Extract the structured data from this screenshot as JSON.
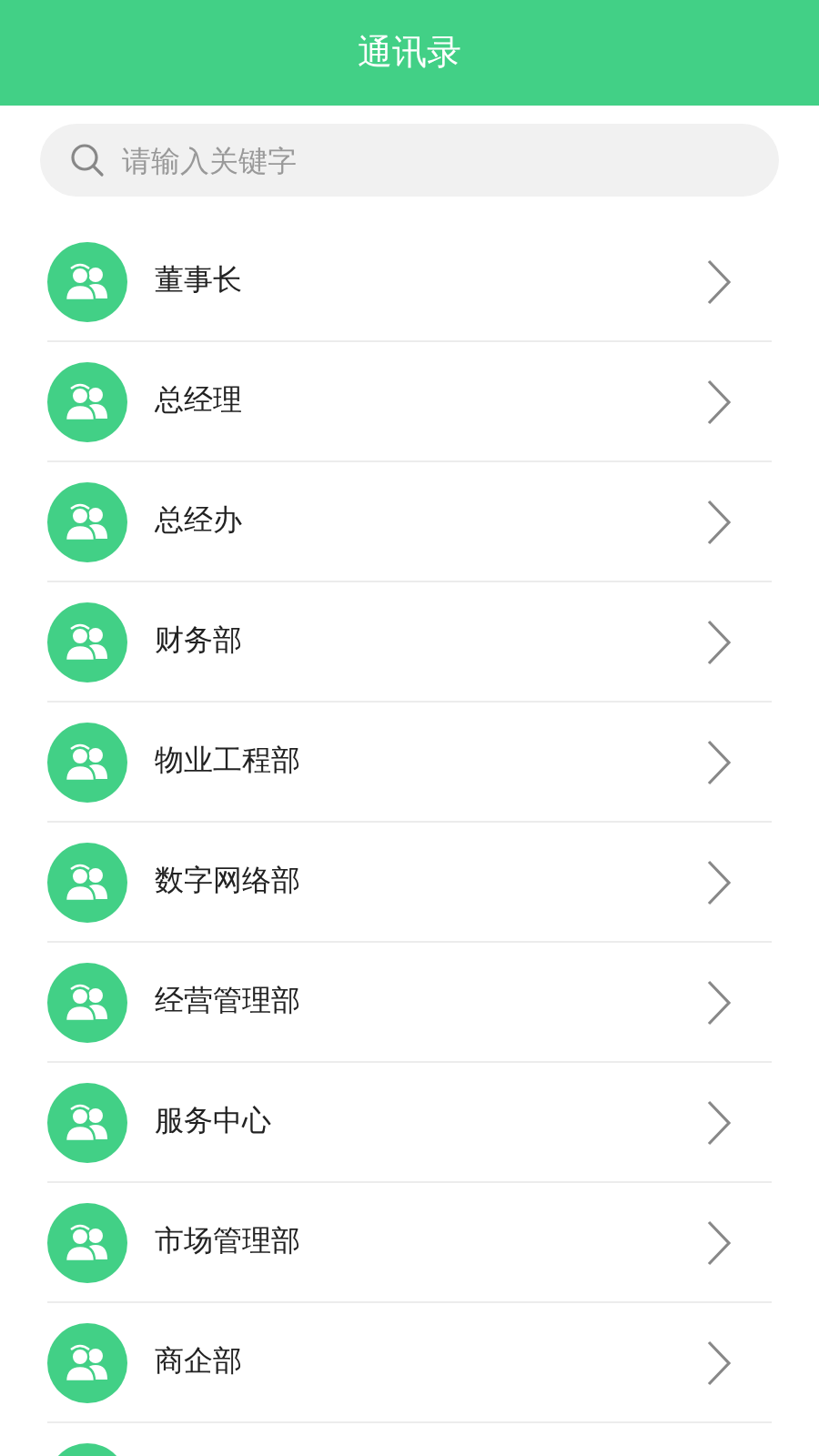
{
  "header": {
    "title": "通讯录"
  },
  "search": {
    "placeholder": "请输入关键字"
  },
  "departments": [
    {
      "kind": "row",
      "name": "董事长"
    },
    {
      "kind": "row",
      "name": "总经理"
    },
    {
      "kind": "row",
      "name": "总经办"
    },
    {
      "kind": "row",
      "name": "财务部"
    },
    {
      "kind": "row",
      "name": "物业工程部"
    },
    {
      "kind": "row",
      "name": "数字网络部"
    },
    {
      "kind": "row",
      "name": "经营管理部"
    },
    {
      "kind": "row",
      "name": "服务中心"
    },
    {
      "kind": "row",
      "name": "市场管理部"
    },
    {
      "kind": "row",
      "name": "商企部"
    },
    {
      "kind": "cut"
    }
  ]
}
